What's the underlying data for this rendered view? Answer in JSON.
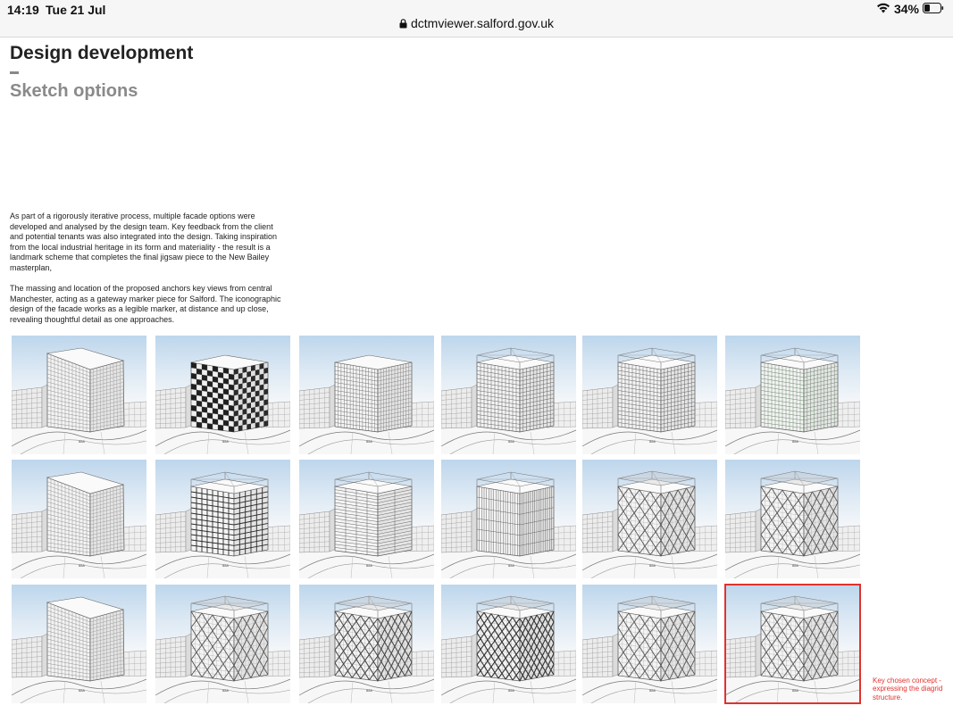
{
  "status_bar": {
    "time": "14:19",
    "date": "Tue 21 Jul",
    "url": "dctmviewer.salford.gov.uk",
    "battery": "34%",
    "icons": [
      "lock-icon",
      "wifi-icon",
      "battery-icon"
    ]
  },
  "page": {
    "title": "Design development",
    "subtitle": "Sketch options",
    "paragraph1": "As part of a rigorously iterative process, multiple facade options were developed and analysed by the design team. Key feedback from the client and potential tenants was also integrated into the design. Taking inspiration from the local industrial heritage in its form and materiality - the result is a landmark scheme that completes the final jigsaw piece to the New Bailey masterplan,",
    "paragraph2": "The massing and location of the proposed anchors key views from central Manchester, acting as a gateway marker piece for Salford. The iconographic design of the facade works as a legible marker, at distance and up close, revealing thoughtful detail as one approaches.",
    "caption": "Key chosen concept - expressing the diagrid structure."
  },
  "sketches": [
    {
      "row": 1,
      "col": 1,
      "variant": "mass-grid"
    },
    {
      "row": 1,
      "col": 2,
      "variant": "dark-checker"
    },
    {
      "row": 1,
      "col": 3,
      "variant": "horizontal-bands"
    },
    {
      "row": 1,
      "col": 4,
      "variant": "crown-grid"
    },
    {
      "row": 1,
      "col": 5,
      "variant": "crown-grid"
    },
    {
      "row": 1,
      "col": 6,
      "variant": "crown-grid-green"
    },
    {
      "row": 2,
      "col": 1,
      "variant": "mass-grid"
    },
    {
      "row": 2,
      "col": 2,
      "variant": "crown-dark-grid"
    },
    {
      "row": 2,
      "col": 3,
      "variant": "crown-horizontal"
    },
    {
      "row": 2,
      "col": 4,
      "variant": "crown-vertical"
    },
    {
      "row": 2,
      "col": 5,
      "variant": "diagrid"
    },
    {
      "row": 2,
      "col": 6,
      "variant": "diagrid"
    },
    {
      "row": 3,
      "col": 1,
      "variant": "mass-grid"
    },
    {
      "row": 3,
      "col": 2,
      "variant": "diagrid"
    },
    {
      "row": 3,
      "col": 3,
      "variant": "diagrid-irregular"
    },
    {
      "row": 3,
      "col": 4,
      "variant": "dense-diagrid"
    },
    {
      "row": 3,
      "col": 5,
      "variant": "diagrid"
    },
    {
      "row": 3,
      "col": 6,
      "variant": "diagrid",
      "highlighted": true
    }
  ]
}
